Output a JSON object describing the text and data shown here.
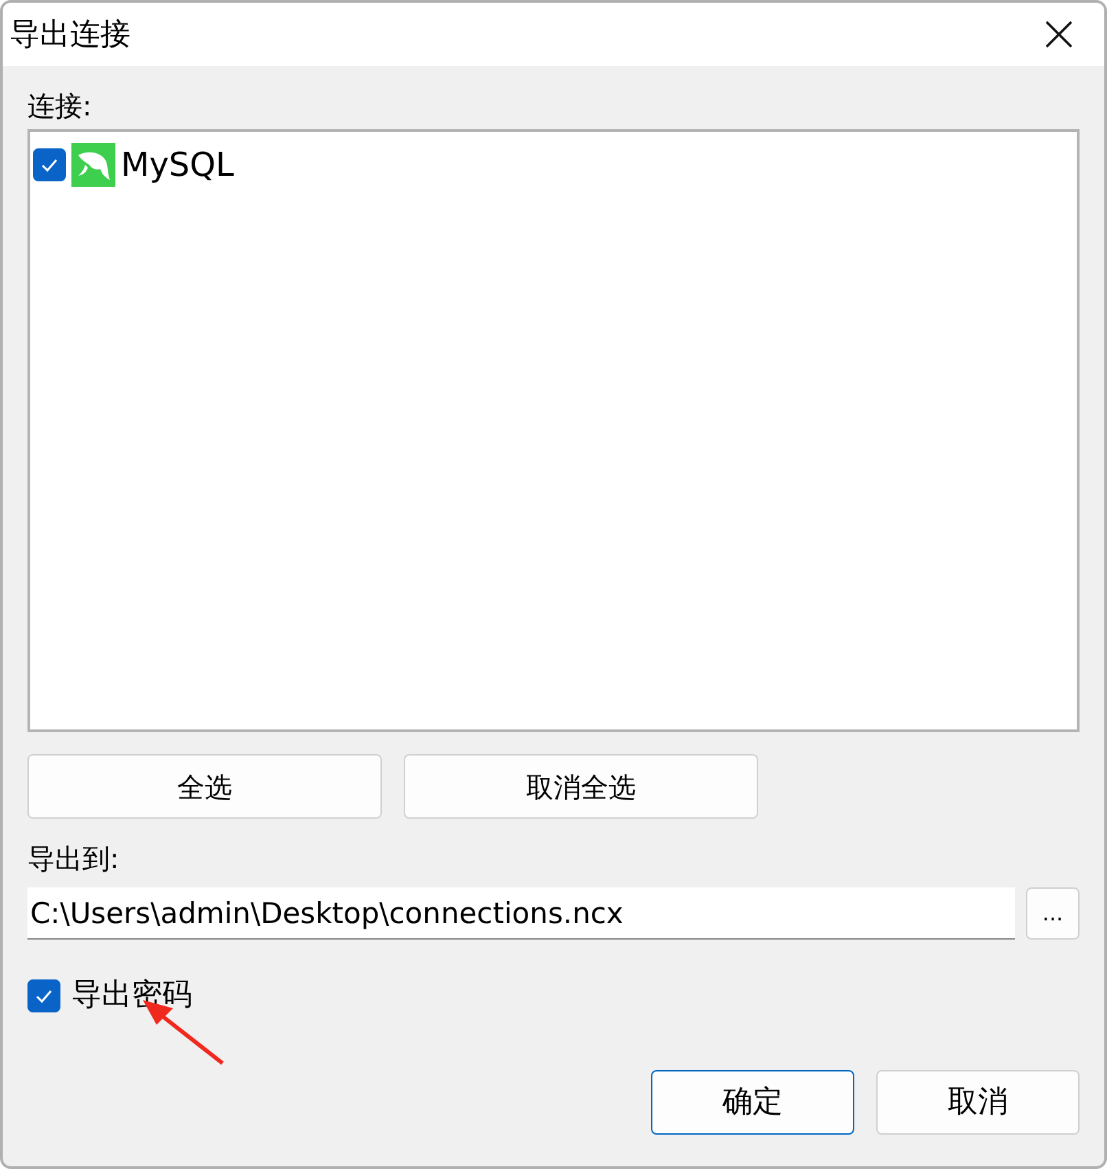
{
  "window": {
    "title": "导出连接"
  },
  "connections": {
    "label": "连接:",
    "items": [
      {
        "name": "MySQL",
        "checked": true
      }
    ]
  },
  "selection_buttons": [
    "全选",
    "取消全选"
  ],
  "export_to": {
    "label": "导出到:",
    "value": "C:\\Users\\admin\\Desktop\\connections.ncx",
    "browse": "..."
  },
  "export_password": {
    "label": "导出密码",
    "checked": true
  },
  "footer_buttons": [
    {
      "label": "确定",
      "default": true
    },
    {
      "label": "取消",
      "default": false
    }
  ]
}
